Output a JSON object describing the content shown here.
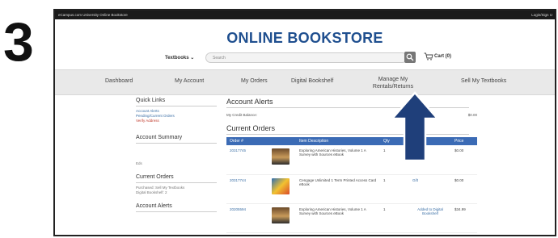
{
  "step_number": "3",
  "topbar": {
    "left": "eCampus.com University Online Bookstore",
    "right": "Login/Sign U"
  },
  "header": {
    "title": "ONLINE BOOKSTORE",
    "textbooks_label": "Textbooks",
    "search_placeholder": "Search",
    "cart_label": "Cart (0)"
  },
  "nav": {
    "items": [
      "Dashboard",
      "My Account",
      "My Orders",
      "Digital Bookshelf",
      "Manage My Rentals/Returns",
      "Sell My Textbooks"
    ]
  },
  "sidebar": {
    "quick_links_title": "Quick Links",
    "quick_links": [
      "Account Alerts",
      "Pending/Current Orders"
    ],
    "verify_address": "Verify Address",
    "account_summary_title": "Account Summary",
    "summary_text": "Eds",
    "current_orders_title": "Current Orders",
    "purchased_text": "Purchased: Sell My Textbooks",
    "digital_text": "Digital Bookshelf: 2",
    "account_alerts_title": "Account Alerts"
  },
  "main": {
    "alerts_title": "Account Alerts",
    "credit_label": "My Credit Balance:",
    "credit_value": "$0.00",
    "orders_title": "Current Orders",
    "columns": [
      "Order #",
      "Item Description",
      "Qty",
      "Status",
      "Price"
    ],
    "rows": [
      {
        "order": "20317745",
        "desc": "Exploring American Histories, Volume 1 A Survey with Sources eBook",
        "qty": "1",
        "status": "",
        "price": "$0.00"
      },
      {
        "order": "20317744",
        "desc": "Cengage Unlimited 1 Term Printed Access Card eBook",
        "qty": "1",
        "status": "Gift",
        "price": "$0.00"
      },
      {
        "order": "20205594",
        "desc": "Exploring American Histories, Volume 1 A Survey with Sources eBook",
        "qty": "1",
        "status": "Added to Digital Bookshelf",
        "price": "$34.99"
      }
    ]
  },
  "colors": {
    "accent": "#3b6bb5",
    "arrow": "#1f3f7a",
    "title": "#1f4f8f"
  }
}
